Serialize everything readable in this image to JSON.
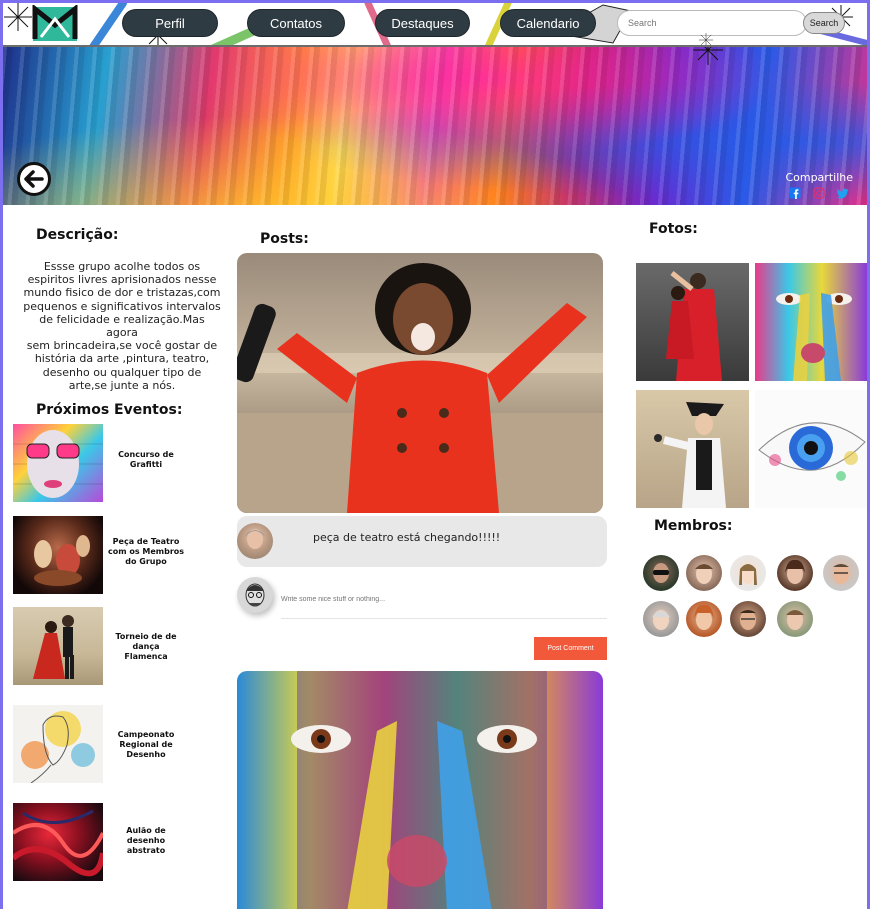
{
  "nav": {
    "items": [
      "Perfil",
      "Contatos",
      "Destaques",
      "Calendario"
    ],
    "search_placeholder": "Search",
    "search_button": "Search"
  },
  "banner": {
    "share_label": "Compartilhe",
    "social_icons": [
      "facebook-icon",
      "instagram-icon",
      "twitter-icon"
    ]
  },
  "left": {
    "description_title": "Descrição:",
    "description_lines": [
      "Essse grupo acolhe todos os",
      "espiritos livres aprisionados nesse",
      "mundo fisico de dor e tristazas,com",
      "pequenos e significativos intervalos",
      "de felicidade e realização.Mas agora",
      "sem brincadeira,se você gostar de",
      "história da arte ,pintura, teatro,",
      "desenho  ou qualquer tipo de",
      "arte,se junte a nós."
    ],
    "events_title": "Próximos Eventos:",
    "events": [
      [
        "Concurso de",
        "Grafitti"
      ],
      [
        "Peça de Teatro",
        "com os Membros",
        "do Grupo"
      ],
      [
        "Torneio de de",
        "dança",
        "Flamenca"
      ],
      [
        "Campeonato",
        "Regional de",
        "Desenho"
      ],
      [
        "Aulão de",
        "desenho",
        "abstrato"
      ]
    ]
  },
  "center": {
    "posts_title": "Posts:",
    "comment_text": "peça de teatro está chegando!!!!!",
    "comment_placeholder": "Write some nice stuff or nothing...",
    "post_comment_button": "Post Comment"
  },
  "right": {
    "photos_title": "Fotos:",
    "members_title": "Membros:"
  },
  "colors": {
    "nav_button": "#2f3b43",
    "post_button": "#f1593a",
    "frame_border": "#7b6ff0",
    "social_icon": "#1877f2"
  }
}
